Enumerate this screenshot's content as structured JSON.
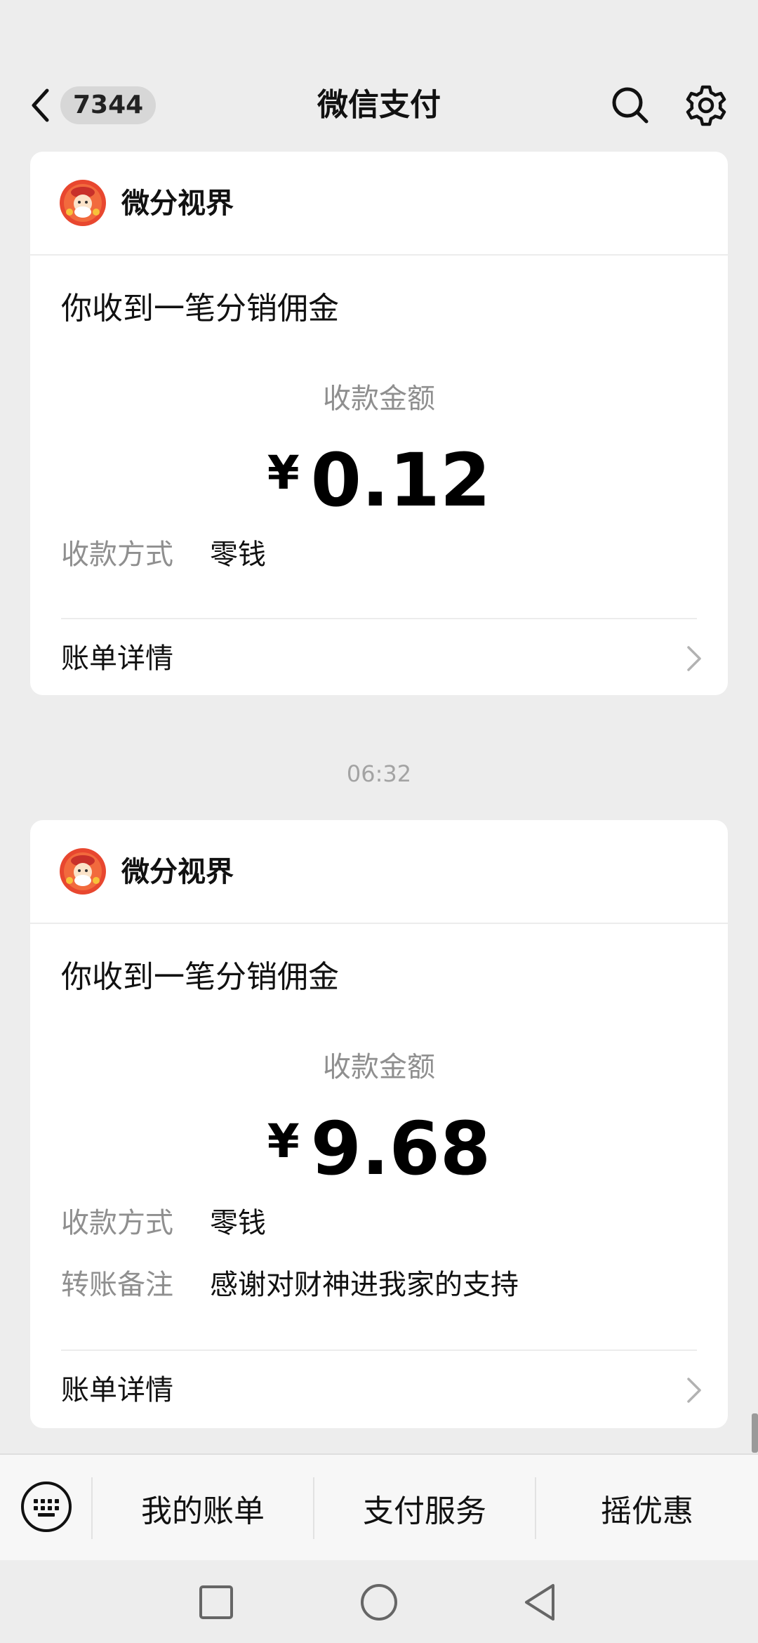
{
  "header": {
    "back_icon": "chevron-left-icon",
    "unread_count": "7344",
    "title": "微信支付",
    "search_icon": "search-icon",
    "settings_icon": "gear-icon"
  },
  "messages": [
    {
      "sender": "微分视界",
      "heading": "你收到一笔分销佣金",
      "amount_label": "收款金额",
      "currency": "¥",
      "amount": "0.12",
      "rows": [
        {
          "label": "收款方式",
          "value": "零钱"
        }
      ],
      "detail_label": "账单详情"
    },
    {
      "timestamp": "06:32",
      "sender": "微分视界",
      "heading": "你收到一笔分销佣金",
      "amount_label": "收款金额",
      "currency": "¥",
      "amount": "9.68",
      "rows": [
        {
          "label": "收款方式",
          "value": "零钱"
        },
        {
          "label": "转账备注",
          "value": "感谢对财神进我家的支持"
        }
      ],
      "detail_label": "账单详情"
    }
  ],
  "bottom_menu": {
    "keyboard_icon": "keyboard-icon",
    "items": [
      "我的账单",
      "支付服务",
      "摇优惠"
    ]
  },
  "system_nav": {
    "icons": [
      "square-recents-icon",
      "circle-home-icon",
      "triangle-back-icon"
    ]
  },
  "colors": {
    "background": "#ededed",
    "card": "#ffffff",
    "secondary_text": "#8f8f8f"
  }
}
